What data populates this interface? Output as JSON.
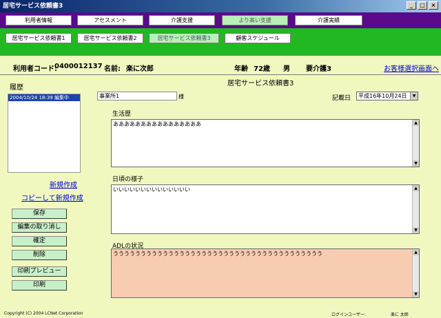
{
  "window": {
    "title": "居宅サービス依頼書3",
    "minimize": "_",
    "maximize": "□",
    "close": "×"
  },
  "nav_primary": [
    "利用者情報",
    "アセスメント",
    "介護支援",
    "より高い支援",
    "介護実績"
  ],
  "nav_secondary": [
    "居宅サービス依頼書1",
    "居宅サービス依頼書2",
    "居宅サービス依頼書3",
    "顧客スケジュール"
  ],
  "user_info": {
    "code_label": "利用者コード:",
    "code": "0400012137",
    "name_label": "名前:",
    "name": "楽に次郎",
    "age_label": "年齢",
    "age": "72歳",
    "gender": "男",
    "care_level": "要介護3",
    "customer_select_link": "お客様選択画面へ"
  },
  "history": {
    "label": "履歴",
    "items": [
      "2004/10/24 18:39 編集中"
    ],
    "new_link": "新規作成",
    "copy_new_link": "コピーして新規作成"
  },
  "actions": {
    "save": "保存",
    "cancel_edit": "編集の取り消し",
    "confirm": "確定",
    "delete": "削除",
    "print_preview": "印刷プレビュー",
    "print": "印刷"
  },
  "form": {
    "title": "居宅サービス依頼書3",
    "office_value": "事業所1",
    "honorific": "様",
    "date_label": "記載日",
    "date_value": "平成16年10月24日",
    "life_history_label": "生活歴",
    "life_history_value": "ああああああああああああああああ",
    "daily_label": "日頃の様子",
    "daily_value": "いいいいいいいいいいいいいい",
    "adl_label": "ADLの状況",
    "adl_value": "うううううううううううううううううううううううううううううううううううううう"
  },
  "footer": {
    "copyright": "Copyright (C) 2004 LCNet Corporation",
    "login_label": "ログインユーザー:",
    "login_user": "楽に 太郎"
  }
}
